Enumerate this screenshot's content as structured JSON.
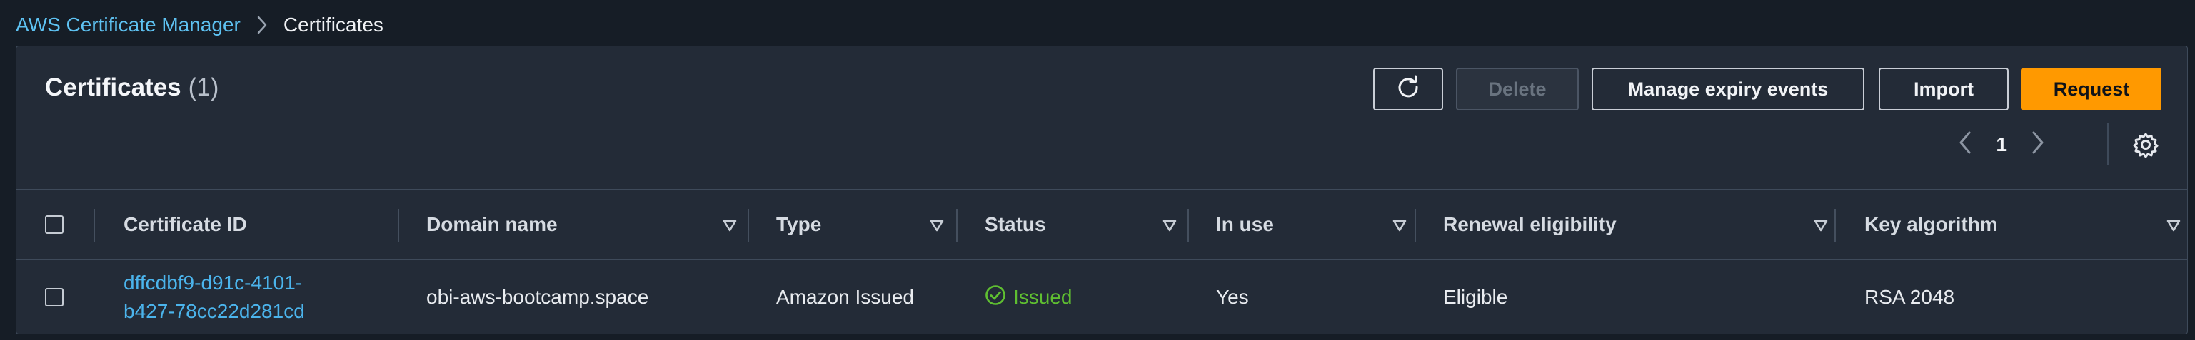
{
  "breadcrumb": {
    "items": [
      {
        "label": "AWS Certificate Manager"
      },
      {
        "label": "Certificates"
      }
    ]
  },
  "panel": {
    "title": "Certificates",
    "count": "(1)"
  },
  "toolbar": {
    "refresh_icon": "refresh-icon",
    "delete_label": "Delete",
    "manage_expiry_label": "Manage expiry events",
    "import_label": "Import",
    "request_label": "Request"
  },
  "pagination": {
    "current_page": "1",
    "prev_icon": "chevron-left-icon",
    "next_icon": "chevron-right-icon",
    "settings_icon": "gear-icon"
  },
  "table": {
    "columns": [
      {
        "label": "Certificate ID",
        "sortable": false
      },
      {
        "label": "Domain name",
        "sortable": true
      },
      {
        "label": "Type",
        "sortable": true
      },
      {
        "label": "Status",
        "sortable": true
      },
      {
        "label": "In use",
        "sortable": true
      },
      {
        "label": "Renewal eligibility",
        "sortable": true
      },
      {
        "label": "Key algorithm",
        "sortable": true
      }
    ],
    "rows": [
      {
        "certificate_id_line1": "dffcdbf9-d91c-4101-",
        "certificate_id_line2": "b427-78cc22d281cd",
        "domain_name": "obi-aws-bootcamp.space",
        "type": "Amazon Issued",
        "status": "Issued",
        "in_use": "Yes",
        "renewal_eligibility": "Eligible",
        "key_algorithm": "RSA 2048"
      }
    ]
  },
  "colors": {
    "background": "#161d26",
    "panel": "#232b37",
    "link": "#4bb4ec",
    "primary": "#ff9900",
    "success": "#5fbf31"
  }
}
